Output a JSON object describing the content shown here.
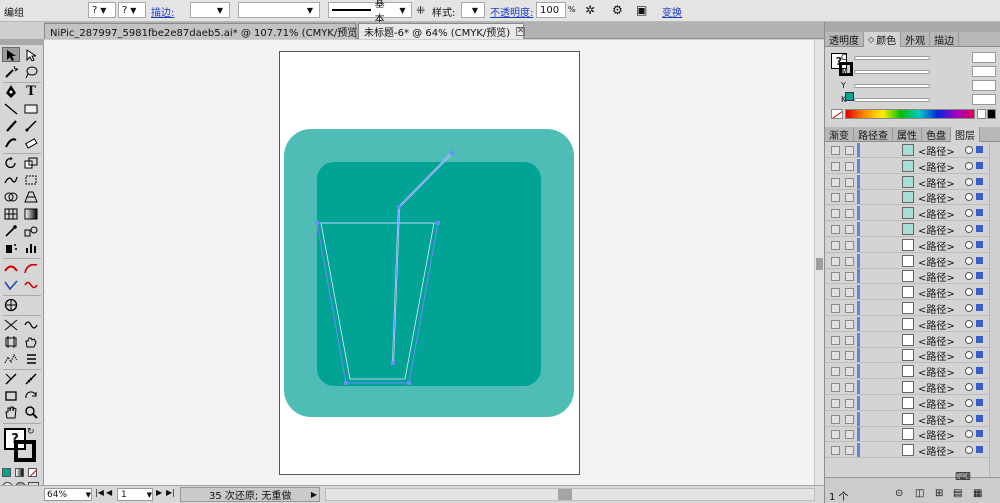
{
  "topbar": {
    "mode": "编组",
    "help_a": "?",
    "help_b": "?",
    "stroke_label": "描边:",
    "brush_label": "基本",
    "style_label": "样式:",
    "opacity_label": "不透明度:",
    "opacity_value": "100",
    "opacity_unit": "%",
    "transform_label": "变换"
  },
  "tabs": [
    {
      "label": "NiPic_287997_5981fbe2e87daeb5.ai* @ 107.71% (CMYK/预览)",
      "close": "✕"
    },
    {
      "label": "未标题-6* @ 64% (CMYK/预览)",
      "close": "✕"
    }
  ],
  "colors": {
    "app_bg": "#cfcfcf",
    "teal_outer": "#4fbdb6",
    "teal_inner": "#00a394",
    "path_blue": "#6a8cff",
    "layer_blue": "#3a5fc4"
  },
  "swatch_letters": [
    "?",
    "C",
    "M",
    "Y",
    "K"
  ],
  "panel_top_tabs": [
    "透明度",
    "颜色",
    "外观",
    "描边"
  ],
  "panel_bottom_tabs": [
    "渐变",
    "路径查",
    "属性",
    "色盘",
    "图层"
  ],
  "layer_row_label": "<路径>",
  "layer_rows": [
    "<路径>",
    "<路径>",
    "<路径>",
    "<路径>",
    "<路径>",
    "<路径>",
    "<路径>",
    "<路径>",
    "<路径>",
    "<路径>",
    "<路径>",
    "<路径>",
    "<路径>",
    "<路径>",
    "<路径>",
    "<路径>",
    "<路径>",
    "<路径>",
    "<路径>",
    "<路径>"
  ],
  "layers_footer": "1 个",
  "status": {
    "zoom": "64%",
    "page": "1",
    "message": "35 次还原; 无重做"
  }
}
